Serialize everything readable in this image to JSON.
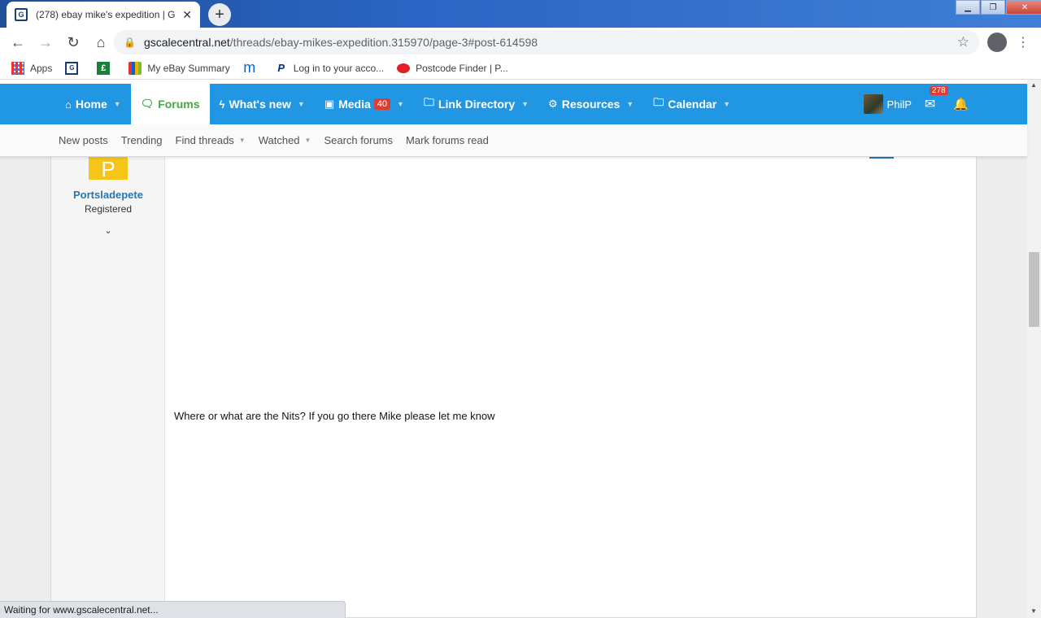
{
  "browser": {
    "tab_title": "(278) ebay mike's expedition | G",
    "tab_close": "✕",
    "new_tab": "+",
    "url_domain": "gscalecentral.net",
    "url_path": "/threads/ebay-mikes-expedition.315970/page-3#post-614598",
    "bookmarks": [
      {
        "label": "Apps",
        "icon": "apps-icon"
      },
      {
        "label": "",
        "icon": "gscale-icon"
      },
      {
        "label": "",
        "icon": "pound-icon"
      },
      {
        "label": "My eBay Summary",
        "icon": "ebay-bag-icon"
      },
      {
        "label": "",
        "icon": "m-icon"
      },
      {
        "label": "Log in to your acco...",
        "icon": "paypal-icon"
      },
      {
        "label": "Postcode Finder | P...",
        "icon": "royal-mail-icon"
      }
    ],
    "status_text": "Waiting for www.gscalecentral.net..."
  },
  "sitenav": {
    "items": [
      {
        "label": "Home",
        "icon": "home-icon",
        "caret": true
      },
      {
        "label": "Forums",
        "icon": "comments-icon",
        "caret": false,
        "active": true
      },
      {
        "label": "What's new",
        "icon": "bolt-icon",
        "caret": true
      },
      {
        "label": "Media",
        "icon": "image-icon",
        "caret": true,
        "badge": "40"
      },
      {
        "label": "Link Directory",
        "icon": "folder-icon",
        "caret": true
      },
      {
        "label": "Resources",
        "icon": "cogs-icon",
        "caret": true
      },
      {
        "label": "Calendar",
        "icon": "folder-icon",
        "caret": true
      }
    ],
    "username": "PhilP",
    "mail_count": "278"
  },
  "subnav": {
    "items": [
      {
        "label": "New posts",
        "caret": false
      },
      {
        "label": "Trending",
        "caret": false
      },
      {
        "label": "Find threads",
        "caret": true
      },
      {
        "label": "Watched",
        "caret": true
      },
      {
        "label": "Search forums",
        "caret": false
      },
      {
        "label": "Mark forums read",
        "caret": false
      }
    ]
  },
  "post": {
    "avatar_letter": "P",
    "avatar_color": "#f5c518",
    "username": "Portsladepete",
    "user_title": "Registered",
    "body": "Where or what are the Nits? If you go there Mike please let me know"
  },
  "colors": {
    "nav_bg": "#2197e3",
    "active_green": "#47a447",
    "link_blue": "#2577b1",
    "badge_red": "#e03c31"
  }
}
